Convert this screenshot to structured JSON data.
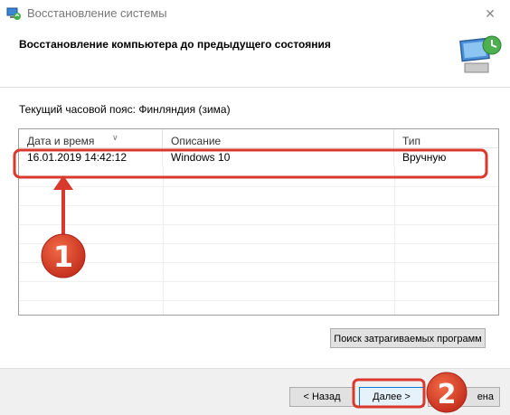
{
  "window": {
    "title": "Восстановление системы",
    "close_icon": "close-icon"
  },
  "header": {
    "title": "Восстановление компьютера до предыдущего состояния",
    "icon": "restore-computer-icon"
  },
  "content": {
    "timezone_label": "Текущий часовой пояс: Финляндия (зима)",
    "table": {
      "columns": [
        "Дата и время",
        "Описание",
        "Тип"
      ],
      "rows": [
        [
          "16.01.2019 14:42:12",
          "Windows 10",
          "Вручную"
        ]
      ]
    },
    "affected_programs_label": "Поиск затрагиваемых программ"
  },
  "footer": {
    "back_label": "< Назад",
    "next_label": "Далее >",
    "cancel_label": "ена"
  },
  "annotations": {
    "marker1": "1",
    "marker2": "2",
    "highlight_color": "#d9382c"
  }
}
